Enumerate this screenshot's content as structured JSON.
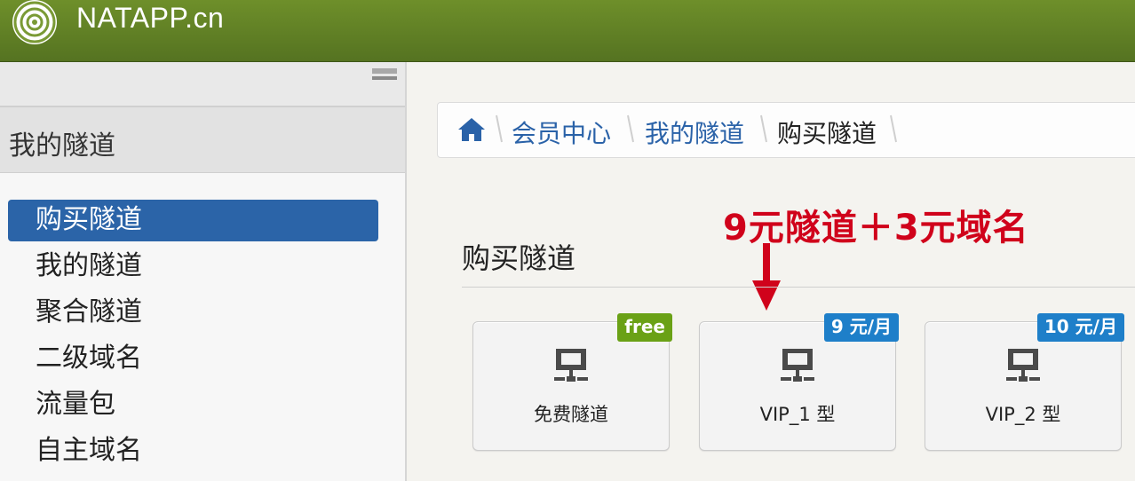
{
  "header": {
    "brand": "NATAPP.cn"
  },
  "sidebar": {
    "section_title": "我的隧道",
    "items": [
      {
        "label": "购买隧道",
        "active": true
      },
      {
        "label": "我的隧道",
        "active": false
      },
      {
        "label": "聚合隧道",
        "active": false
      },
      {
        "label": "二级域名",
        "active": false
      },
      {
        "label": "流量包",
        "active": false
      },
      {
        "label": "自主域名",
        "active": false
      }
    ]
  },
  "breadcrumb": {
    "items": [
      "会员中心",
      "我的隧道",
      "购买隧道"
    ]
  },
  "annotation": "9元隧道＋3元域名",
  "page": {
    "title": "购买隧道"
  },
  "cards": [
    {
      "label": "免费隧道",
      "badge": "free",
      "badge_color": "#6aa116"
    },
    {
      "label": "VIP_1 型",
      "badge": "9 元/月",
      "badge_color": "#1e7fc9"
    },
    {
      "label": "VIP_2 型",
      "badge": "10 元/月",
      "badge_color": "#1e7fc9"
    }
  ],
  "colors": {
    "header_green": "#6e8f2a",
    "active_blue": "#2b64a8",
    "link_blue": "#2a62a8",
    "annotation_red": "#d0021b"
  }
}
